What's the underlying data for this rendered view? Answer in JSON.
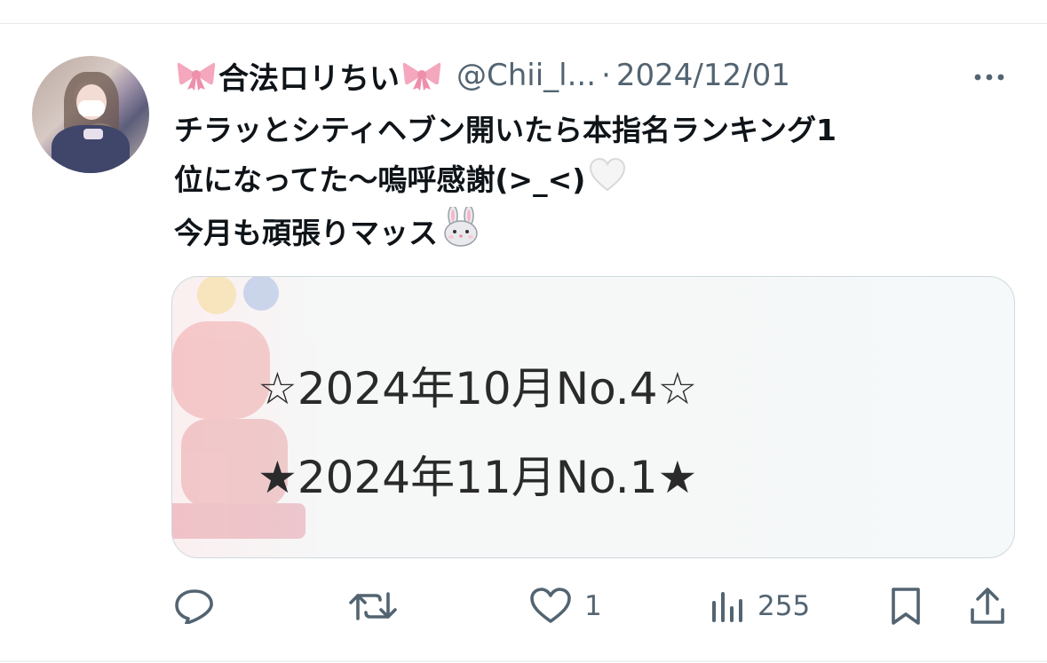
{
  "author": {
    "display_name": "合法ロリちい",
    "handle": "@Chii_l...",
    "separator": "·",
    "date": "2024/12/01"
  },
  "tweet": {
    "lines": [
      "チラッとシティヘブン開いたら本指名ランキング1",
      "位になってた〜嗚呼感謝(>_<)",
      "今月も頑張りマッス"
    ]
  },
  "media": {
    "line1": "☆2024年10月No.4☆",
    "line2": "★2024年11月No.1★"
  },
  "actions": {
    "like_count": "1",
    "view_count": "255"
  },
  "icons": {
    "ribbon": "ribbon-icon",
    "heart_emoji": "white-heart-icon",
    "rabbit_emoji": "rabbit-face-icon",
    "more": "more-icon",
    "reply": "reply-icon",
    "retweet": "retweet-icon",
    "like": "heart-icon",
    "views": "views-icon",
    "bookmark": "bookmark-icon",
    "share": "share-icon"
  },
  "colors": {
    "text": "#0f1419",
    "secondary": "#536471",
    "ribbon": "#f4a7bd",
    "border": "#cfd9de"
  }
}
